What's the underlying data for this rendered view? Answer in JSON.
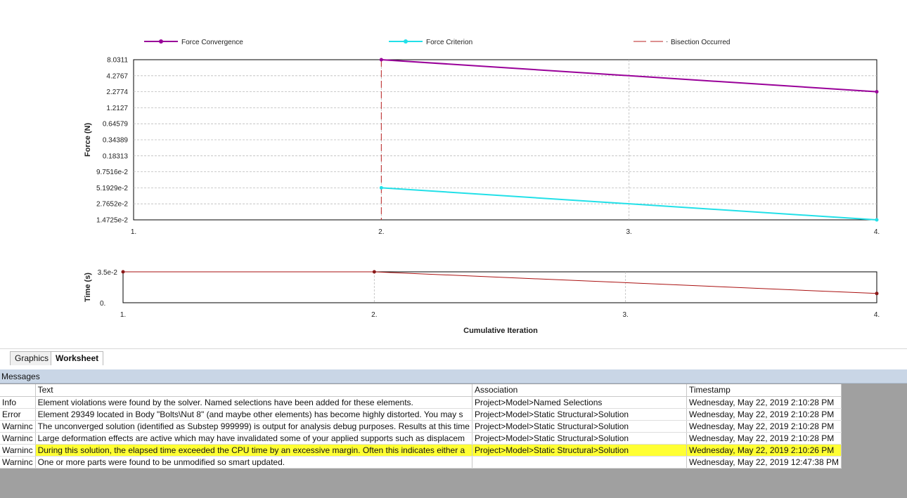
{
  "legend": {
    "items": [
      {
        "label": "Force Convergence",
        "color": "#990099",
        "style": "solid-marker"
      },
      {
        "label": "Force Criterion",
        "color": "#22e0e8",
        "style": "solid-marker"
      },
      {
        "label": "Bisection Occurred",
        "color": "#bb2222",
        "style": "dashed"
      }
    ]
  },
  "chart_data": [
    {
      "type": "line",
      "ylabel": "Force (N)",
      "yscale": "log",
      "ylim": [
        0.014725,
        8.0311
      ],
      "y_ticks": [
        "8.0311",
        "4.2767",
        "2.2774",
        "1.2127",
        "0.64579",
        "0.34389",
        "0.18313",
        "9.7516e-2",
        "5.1929e-2",
        "2.7652e-2",
        "1.4725e-2"
      ],
      "x_ticks": [
        "1.",
        "2.",
        "3.",
        "4."
      ],
      "xlim": [
        1,
        4
      ],
      "grid": true,
      "series": [
        {
          "name": "Force Convergence",
          "color": "#990099",
          "x": [
            2,
            4
          ],
          "y": [
            8.0311,
            2.2774
          ]
        },
        {
          "name": "Force Criterion",
          "color": "#22e0e8",
          "x": [
            2,
            4
          ],
          "y": [
            0.052,
            0.014725
          ]
        }
      ],
      "bisection_x": [
        2
      ]
    },
    {
      "type": "line",
      "ylabel": "Time (s)",
      "xlabel": "Cumulative Iteration",
      "ylim": [
        0,
        0.035
      ],
      "y_ticks": [
        "3.5e-2",
        "0."
      ],
      "x_ticks": [
        "1.",
        "2.",
        "3.",
        "4."
      ],
      "xlim": [
        1,
        4
      ],
      "grid": true,
      "series": [
        {
          "name": "Time",
          "color": "#aa1111",
          "x": [
            1,
            2,
            4
          ],
          "y": [
            0.035,
            0.035,
            0.0105
          ]
        }
      ]
    }
  ],
  "tabs": [
    {
      "label": "Graphics",
      "active": false
    },
    {
      "label": "Worksheet",
      "active": true
    }
  ],
  "messages": {
    "title": "Messages",
    "columns": [
      "",
      "Text",
      "Association",
      "Timestamp"
    ],
    "highlight_color": "#ffff33",
    "rows": [
      {
        "type": "Info",
        "text": "Element violations were found by the solver.  Named selections have been added for these elements.",
        "association": "Project>Model>Named Selections",
        "timestamp": "Wednesday, May 22, 2019 2:10:28 PM",
        "highlight": false
      },
      {
        "type": "Error",
        "text": "Element 29349 located in Body \"Bolts\\Nut 8\" (and maybe other elements) has become highly distorted.  You may s",
        "association": "Project>Model>Static Structural>Solution",
        "timestamp": "Wednesday, May 22, 2019 2:10:28 PM",
        "highlight": false
      },
      {
        "type": "Warninc",
        "text": "The unconverged solution (identified as Substep 999999) is output for analysis debug purposes. Results at this time",
        "association": "Project>Model>Static Structural>Solution",
        "timestamp": "Wednesday, May 22, 2019 2:10:28 PM",
        "highlight": false
      },
      {
        "type": "Warninc",
        "text": "Large deformation effects are active which may have invalidated some of your applied supports such as displacem",
        "association": "Project>Model>Static Structural>Solution",
        "timestamp": "Wednesday, May 22, 2019 2:10:28 PM",
        "highlight": false
      },
      {
        "type": "Warninc",
        "text": "During this solution, the elapsed time exceeded the CPU time by an excessive margin.  Often this indicates either a",
        "association": "Project>Model>Static Structural>Solution",
        "timestamp": "Wednesday, May 22, 2019 2:10:26 PM",
        "highlight": true
      },
      {
        "type": "Warninc",
        "text": "One or more parts were found to be unmodified so smart updated.",
        "association": "",
        "timestamp": "Wednesday, May 22, 2019 12:47:38 PM",
        "highlight": false
      }
    ]
  }
}
